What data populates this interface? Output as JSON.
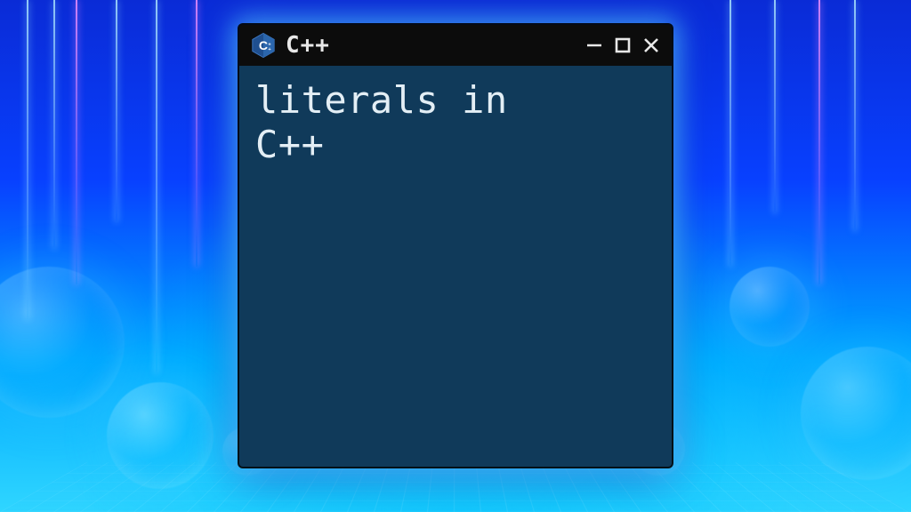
{
  "window": {
    "title": "C++",
    "icon_name": "cpp-logo-icon"
  },
  "content": {
    "line1": "literals in",
    "line2": "C++"
  },
  "colors": {
    "titlebar_bg": "#0c0c0c",
    "client_bg": "#103a5a",
    "text": "#e3eef5"
  }
}
